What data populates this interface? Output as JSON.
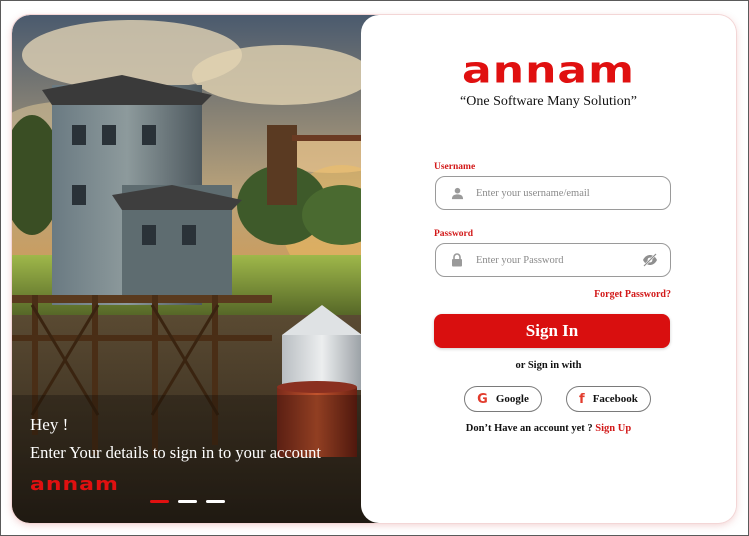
{
  "hero": {
    "greeting": "Hey !",
    "subtitle": "Enter Your details to sign in to your account",
    "logo_text": "annam",
    "slides": [
      {
        "active": true
      },
      {
        "active": false
      },
      {
        "active": false
      }
    ]
  },
  "brand": {
    "logo_text": "annam",
    "tagline": "“One Software Many Solution”"
  },
  "form": {
    "username_label": "Username",
    "username_placeholder": "Enter your username/email",
    "password_label": "Password",
    "password_placeholder": "Enter your Password",
    "forgot_label": "Forget Password?",
    "signin_label": "Sign In",
    "or_text": "or Sign in with",
    "google_label": "Google",
    "facebook_label": "Facebook",
    "no_account_text": "Don’t Have an account yet ?",
    "signup_label": "Sign Up"
  },
  "colors": {
    "accent": "#d90f0f",
    "label_red": "#d21919",
    "input_border": "#9a9a9a"
  },
  "icons": {
    "username": "user-icon",
    "password": "lock-icon",
    "toggle": "eye-off-icon",
    "google": "google-icon",
    "facebook": "facebook-icon"
  }
}
